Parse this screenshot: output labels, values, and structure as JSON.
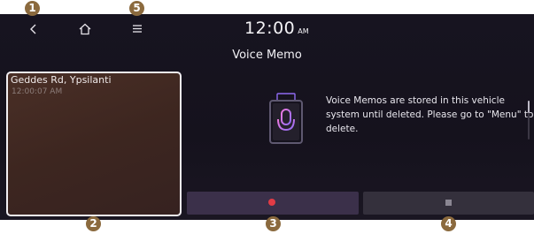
{
  "callouts": [
    "1",
    "2",
    "3",
    "4",
    "5"
  ],
  "clock": {
    "time": "12:00",
    "ampm": "AM"
  },
  "title": "Voice Memo",
  "memo": {
    "location": "Geddes Rd, Ypsilanti",
    "timestamp": "12:00:07 AM"
  },
  "message": "Voice Memos are stored in this vehicle system until deleted. Please go to \"Menu\" to delete.",
  "icons": {
    "back": "chevron-left-icon",
    "home": "home-icon",
    "menu": "menu-icon",
    "mic": "microphone-icon",
    "record": "record-icon",
    "stop": "stop-icon"
  },
  "colors": {
    "background": "#171420",
    "badge": "#8b6a3e",
    "record_dot": "#e23b45",
    "mic_glow": "#c659e8",
    "card": "#3d2620"
  }
}
